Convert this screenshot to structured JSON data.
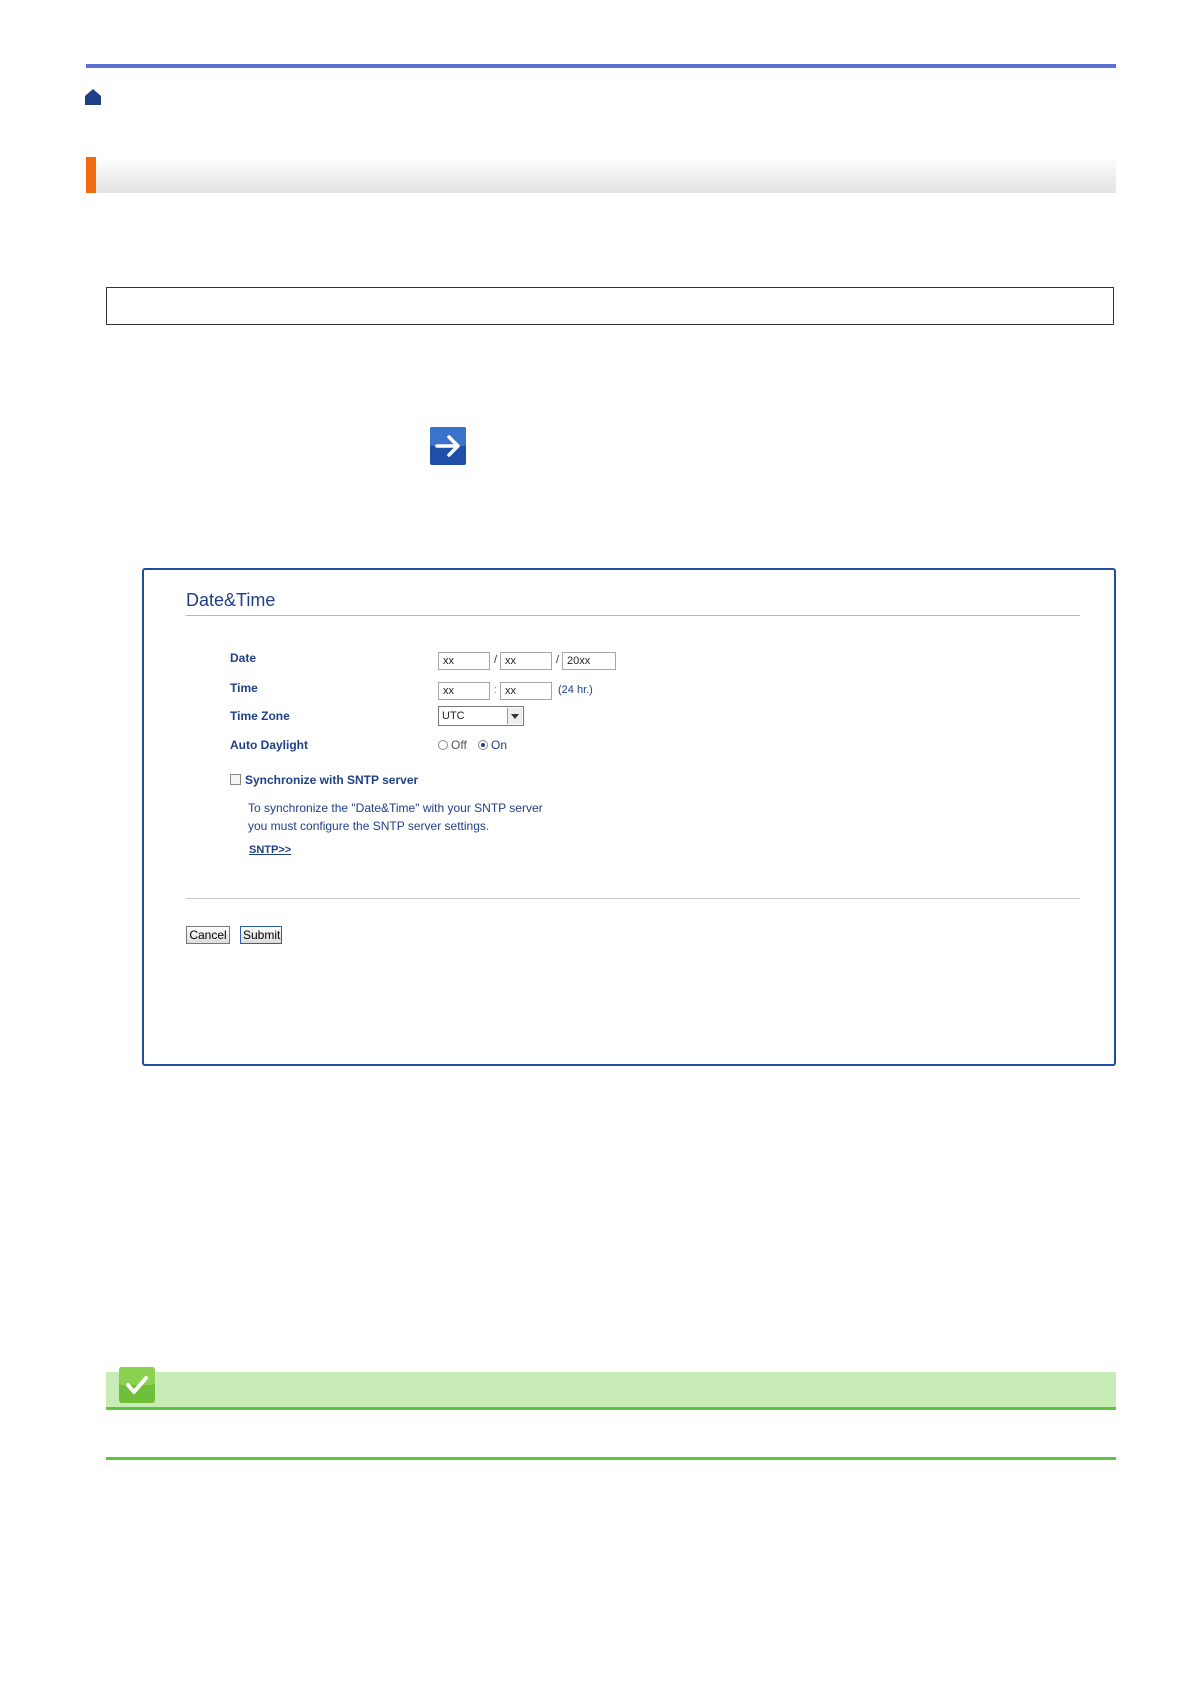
{
  "dialog": {
    "title": "Date&Time",
    "date": {
      "label": "Date",
      "month": "xx",
      "sep1": "/",
      "day": "xx",
      "sep2": "/",
      "year": "20xx"
    },
    "time": {
      "label": "Time",
      "hour": "xx",
      "sep": ":",
      "minute": "xx",
      "hint": "(24 hr.)"
    },
    "timezone": {
      "label": "Time Zone",
      "value": "UTC"
    },
    "auto_daylight": {
      "label": "Auto Daylight",
      "off_label": "Off",
      "on_label": "On",
      "selected": "On"
    },
    "sync": {
      "label": "Synchronize with SNTP server",
      "checked": false,
      "text_line1": "To synchronize the \"Date&Time\" with your SNTP server",
      "text_line2": "you must configure the SNTP server settings.",
      "link": "SNTP>>"
    },
    "cancel_label": "Cancel",
    "submit_label": "Submit"
  },
  "colors": {
    "top_rule": "#5b6ed1",
    "accent_orange": "#f06a10",
    "dialog_border": "#1f4e9c",
    "label_blue": "#1f3f86",
    "note_green": "#5fc33d",
    "note_band": "#c9ecb6"
  },
  "icons": {
    "home": "home-icon",
    "arrow": "arrow-right-icon",
    "note": "checkmark-icon"
  }
}
